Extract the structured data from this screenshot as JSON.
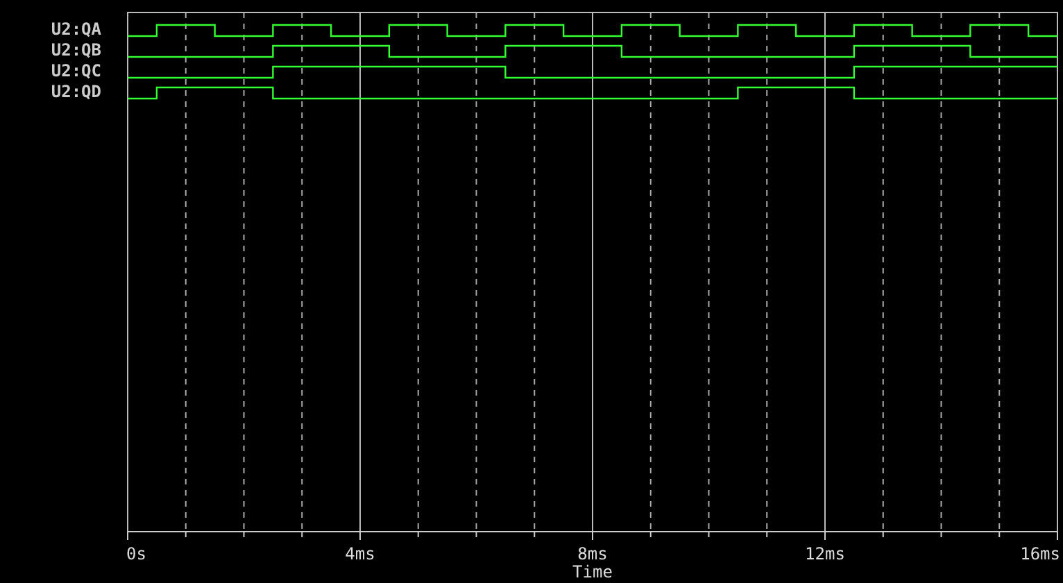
{
  "plot": {
    "signals": [
      {
        "name": "U2:QA"
      },
      {
        "name": "U2:QB"
      },
      {
        "name": "U2:QC"
      },
      {
        "name": "U2:QD"
      }
    ],
    "x_axis": {
      "ticks": [
        "0s",
        "4ms",
        "8ms",
        "12ms",
        "16ms"
      ],
      "title": "Time"
    }
  }
}
